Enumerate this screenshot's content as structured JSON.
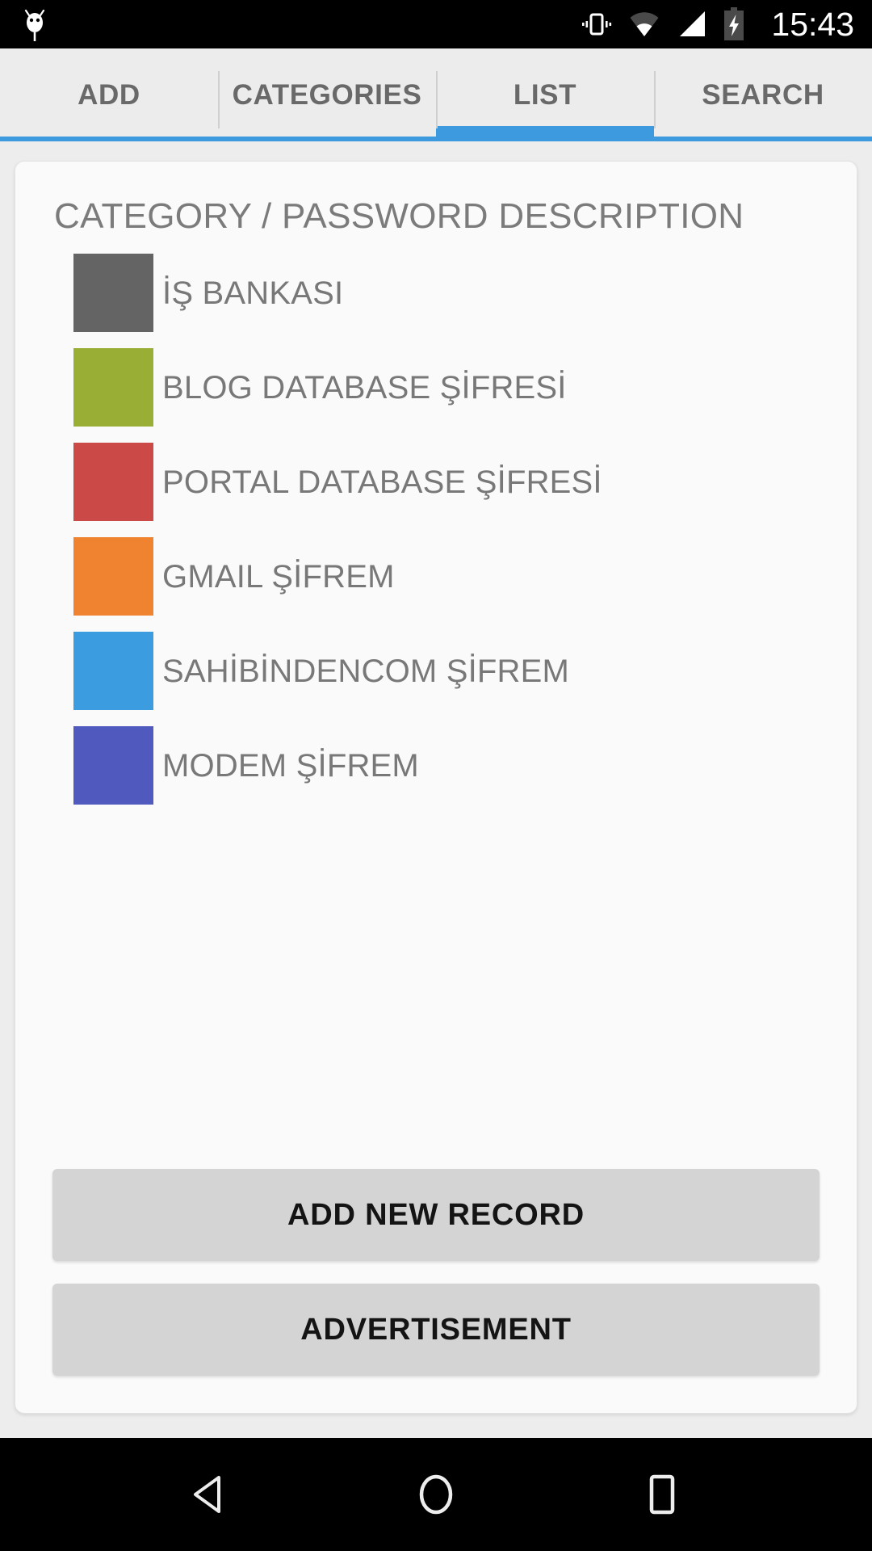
{
  "status_bar": {
    "app_icon": "android-droid-icon",
    "icons": [
      "vibrate-icon",
      "wifi-icon",
      "signal-icon",
      "battery-charging-icon"
    ],
    "time": "15:43"
  },
  "tabs": [
    {
      "label": "ADD",
      "active": false
    },
    {
      "label": "CATEGORIES",
      "active": false
    },
    {
      "label": "LIST",
      "active": true
    },
    {
      "label": "SEARCH",
      "active": false
    }
  ],
  "card": {
    "title": "CATEGORY / PASSWORD DESCRIPTION",
    "records": [
      {
        "label": "İŞ BANKASI",
        "color": "#646464"
      },
      {
        "label": "BLOG DATABASE ŞİFRESİ",
        "color": "#99ae35"
      },
      {
        "label": "PORTAL DATABASE ŞİFRESİ",
        "color": "#cb4a48"
      },
      {
        "label": "GMAIL ŞİFREM",
        "color": "#f0832f"
      },
      {
        "label": "SAHİBİNDENCOM ŞİFREM",
        "color": "#3b9ce0"
      },
      {
        "label": "MODEM ŞİFREM",
        "color": "#5059be"
      }
    ],
    "buttons": [
      {
        "label": "ADD NEW RECORD"
      },
      {
        "label": "ADVERTISEMENT"
      }
    ]
  },
  "nav_bar": {
    "back": "back-triangle-icon",
    "home": "home-circle-icon",
    "recents": "recents-square-icon"
  },
  "colors": {
    "accent": "#3d9ade",
    "tab_text": "#696969",
    "card_bg": "#fafafa",
    "page_bg": "#ededed",
    "button_bg": "#d4d4d4"
  }
}
